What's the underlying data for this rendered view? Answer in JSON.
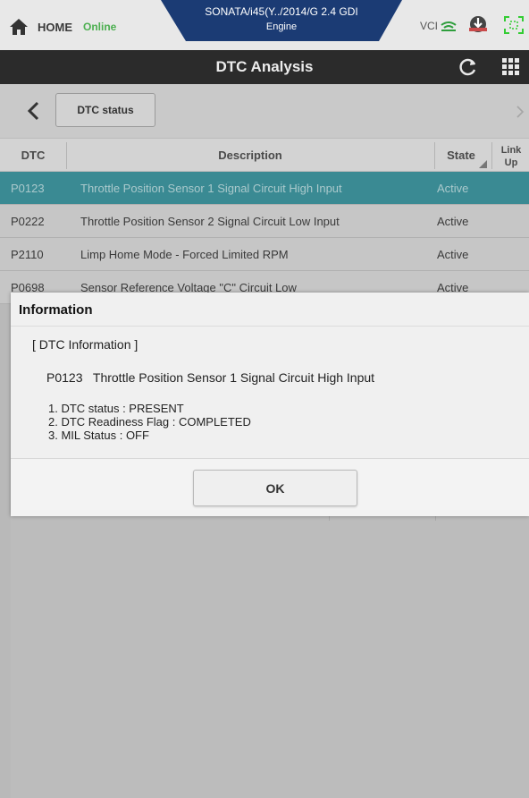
{
  "topbar": {
    "home_label": "HOME",
    "status": "Online",
    "vehicle_name": "SONATA/i45(Y../2014/G 2.4 GDI",
    "vehicle_system": "Engine",
    "vci_label": "VCI",
    "colors": {
      "online": "#4caf50",
      "vehicle_tab": "#1b3b74",
      "scan_icon": "#33cc33"
    }
  },
  "titlebar": {
    "title": "DTC Analysis",
    "refresh_icon": "refresh-icon",
    "grid_icon": "grid-menu-icon"
  },
  "nav": {
    "back_icon": "chevron-left-icon",
    "status_button": "DTC status",
    "forward_icon": "chevron-right-icon"
  },
  "table": {
    "headers": {
      "dtc": "DTC",
      "description": "Description",
      "state": "State",
      "link_up": "Link Up"
    },
    "rows": [
      {
        "code": "P0123",
        "description": "Throttle Position Sensor 1 Signal Circuit High Input",
        "state": "Active",
        "selected": true
      },
      {
        "code": "P0222",
        "description": "Throttle Position Sensor 2 Signal Circuit Low Input",
        "state": "Active",
        "selected": false
      },
      {
        "code": "P2110",
        "description": "Limp Home Mode - Forced Limited RPM",
        "state": "Active",
        "selected": false
      },
      {
        "code": "P0698",
        "description": "Sensor Reference Voltage \"C\" Circuit Low",
        "state": "Active",
        "selected": false
      }
    ],
    "colors": {
      "selected_row": "#3a8a93"
    }
  },
  "dialog": {
    "title": "Information",
    "section": "[ DTC Information ]",
    "dtc_line": "P0123   Throttle Position Sensor 1 Signal Circuit High Input",
    "items": [
      "1. DTC status : PRESENT",
      "2. DTC Readiness Flag : COMPLETED",
      "3. MIL Status : OFF"
    ],
    "ok_label": "OK"
  }
}
